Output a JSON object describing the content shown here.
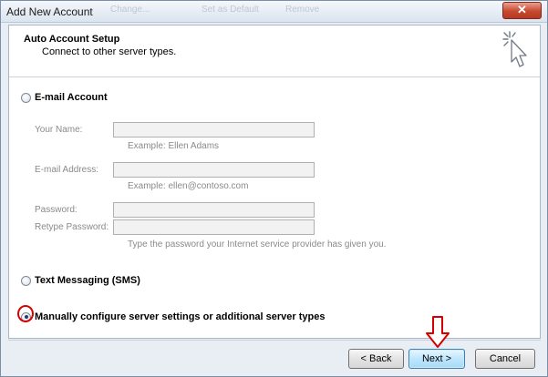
{
  "window": {
    "title": "Add New Account",
    "ghost_labels": [
      "Change...",
      "Set as Default",
      "Remove"
    ],
    "close_glyph": "✕"
  },
  "header": {
    "title": "Auto Account Setup",
    "subtitle": "Connect to other server types.",
    "icon": "wizard-cursor-icon"
  },
  "email_account": {
    "option_label": "E-mail Account",
    "selected": false,
    "your_name_label": "Your Name:",
    "your_name_value": "",
    "your_name_hint": "Example: Ellen Adams",
    "email_label": "E-mail Address:",
    "email_value": "",
    "email_hint": "Example: ellen@contoso.com",
    "password_label": "Password:",
    "password_value": "",
    "retype_label": "Retype Password:",
    "retype_value": "",
    "password_hint": "Type the password your Internet service provider has given you."
  },
  "sms": {
    "option_label": "Text Messaging (SMS)",
    "selected": false
  },
  "manual": {
    "option_label": "Manually configure server settings or additional server types",
    "selected": true
  },
  "buttons": {
    "back": "< Back",
    "next": "Next >",
    "cancel": "Cancel"
  },
  "annotations": {
    "highlight_color": "#d60000"
  }
}
